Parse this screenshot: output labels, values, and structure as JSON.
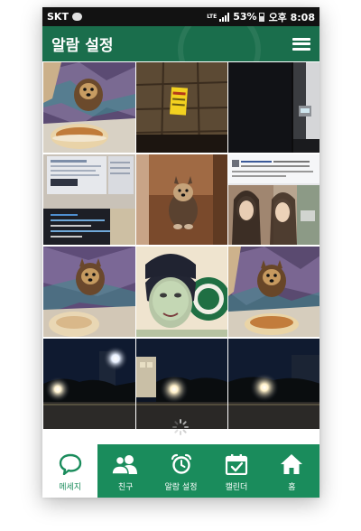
{
  "status_bar": {
    "carrier": "SKT",
    "network": "LTE",
    "battery": "53%",
    "time": "오후 8:08"
  },
  "header": {
    "title": "알람 설정"
  },
  "gallery": {
    "photos": [
      {
        "name": "photo-yorkie-on-blanket"
      },
      {
        "name": "photo-floor-tiles-sign"
      },
      {
        "name": "photo-dark-doorway"
      },
      {
        "name": "photo-monitor-screen"
      },
      {
        "name": "photo-yorkie-sitting-floor"
      },
      {
        "name": "photo-social-post-screenshot"
      },
      {
        "name": "photo-yorkie-on-blanket-2"
      },
      {
        "name": "photo-face-filter-starbucks"
      },
      {
        "name": "photo-yorkie-on-blanket-3"
      },
      {
        "name": "photo-night-street-light-1"
      },
      {
        "name": "photo-night-street-light-2"
      },
      {
        "name": "photo-night-street-light-3"
      }
    ]
  },
  "tab_bar": {
    "tabs": [
      {
        "label": "메세지",
        "icon": "chat-bubble-icon",
        "active": true
      },
      {
        "label": "친구",
        "icon": "friends-icon",
        "active": false
      },
      {
        "label": "알람 설정",
        "icon": "alarm-clock-icon",
        "active": false
      },
      {
        "label": "캘린더",
        "icon": "calendar-icon",
        "active": false
      },
      {
        "label": "홈",
        "icon": "home-icon",
        "active": false
      }
    ]
  },
  "colors": {
    "header": "#1a6e4c",
    "tab_bar": "#1a8c5c",
    "status_bar": "#121212"
  }
}
